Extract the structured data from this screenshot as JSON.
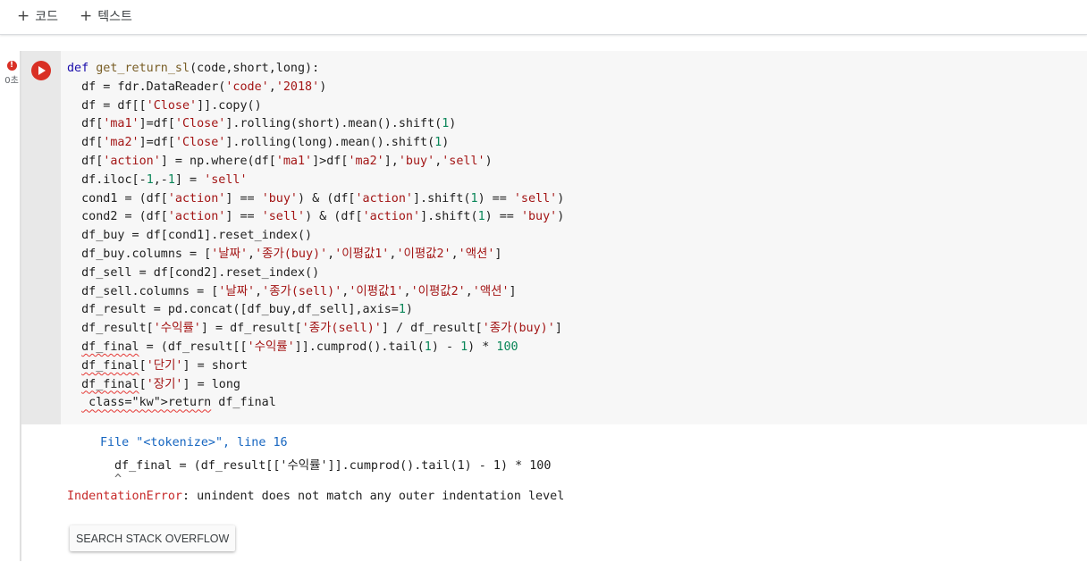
{
  "toolbar": {
    "add_code_label": "코드",
    "add_text_label": "텍스트"
  },
  "cell": {
    "status_icon": "error-icon",
    "status_glyph": "!",
    "exec_time": "0초",
    "accent_color": "#d93025",
    "code": [
      "def get_return_sl(code,short,long):",
      "  df = fdr.DataReader('code','2018')",
      "  df = df[['Close']].copy()",
      "  df['ma1']=df['Close'].rolling(short).mean().shift(1)",
      "  df['ma2']=df['Close'].rolling(long).mean().shift(1)",
      "  df['action'] = np.where(df['ma1']>df['ma2'],'buy','sell')",
      "  df.iloc[-1,-1] = 'sell'",
      "  cond1 = (df['action'] == 'buy') & (df['action'].shift(1) == 'sell')",
      "  cond2 = (df['action'] == 'sell') & (df['action'].shift(1) == 'buy')",
      "  df_buy = df[cond1].reset_index()",
      "  df_buy.columns = ['날짜','종가(buy)','이평값1','이평값2','액션']",
      "  df_sell = df[cond2].reset_index()",
      "  df_sell.columns = ['날짜','종가(sell)','이평값1','이평값2','액션']",
      "  df_result = pd.concat([df_buy,df_sell],axis=1)",
      "  df_result['수익률'] = df_result['종가(sell)'] / df_result['종가(buy)']",
      "  df_final = (df_result[['수익률']].cumprod().tail(1) - 1) * 100",
      "  df_final['단기'] = short",
      "  df_final['장기'] = long",
      "  return df_final"
    ]
  },
  "output": {
    "file_line": "File \"<tokenize>\", line 16",
    "code_line": "df_final = (df_result[['수익률']].cumprod().tail(1) - 1) * 100",
    "caret": "^",
    "error_type": "IndentationError",
    "error_message": ": unindent does not match any outer indentation level",
    "search_button": "SEARCH STACK OVERFLOW"
  }
}
